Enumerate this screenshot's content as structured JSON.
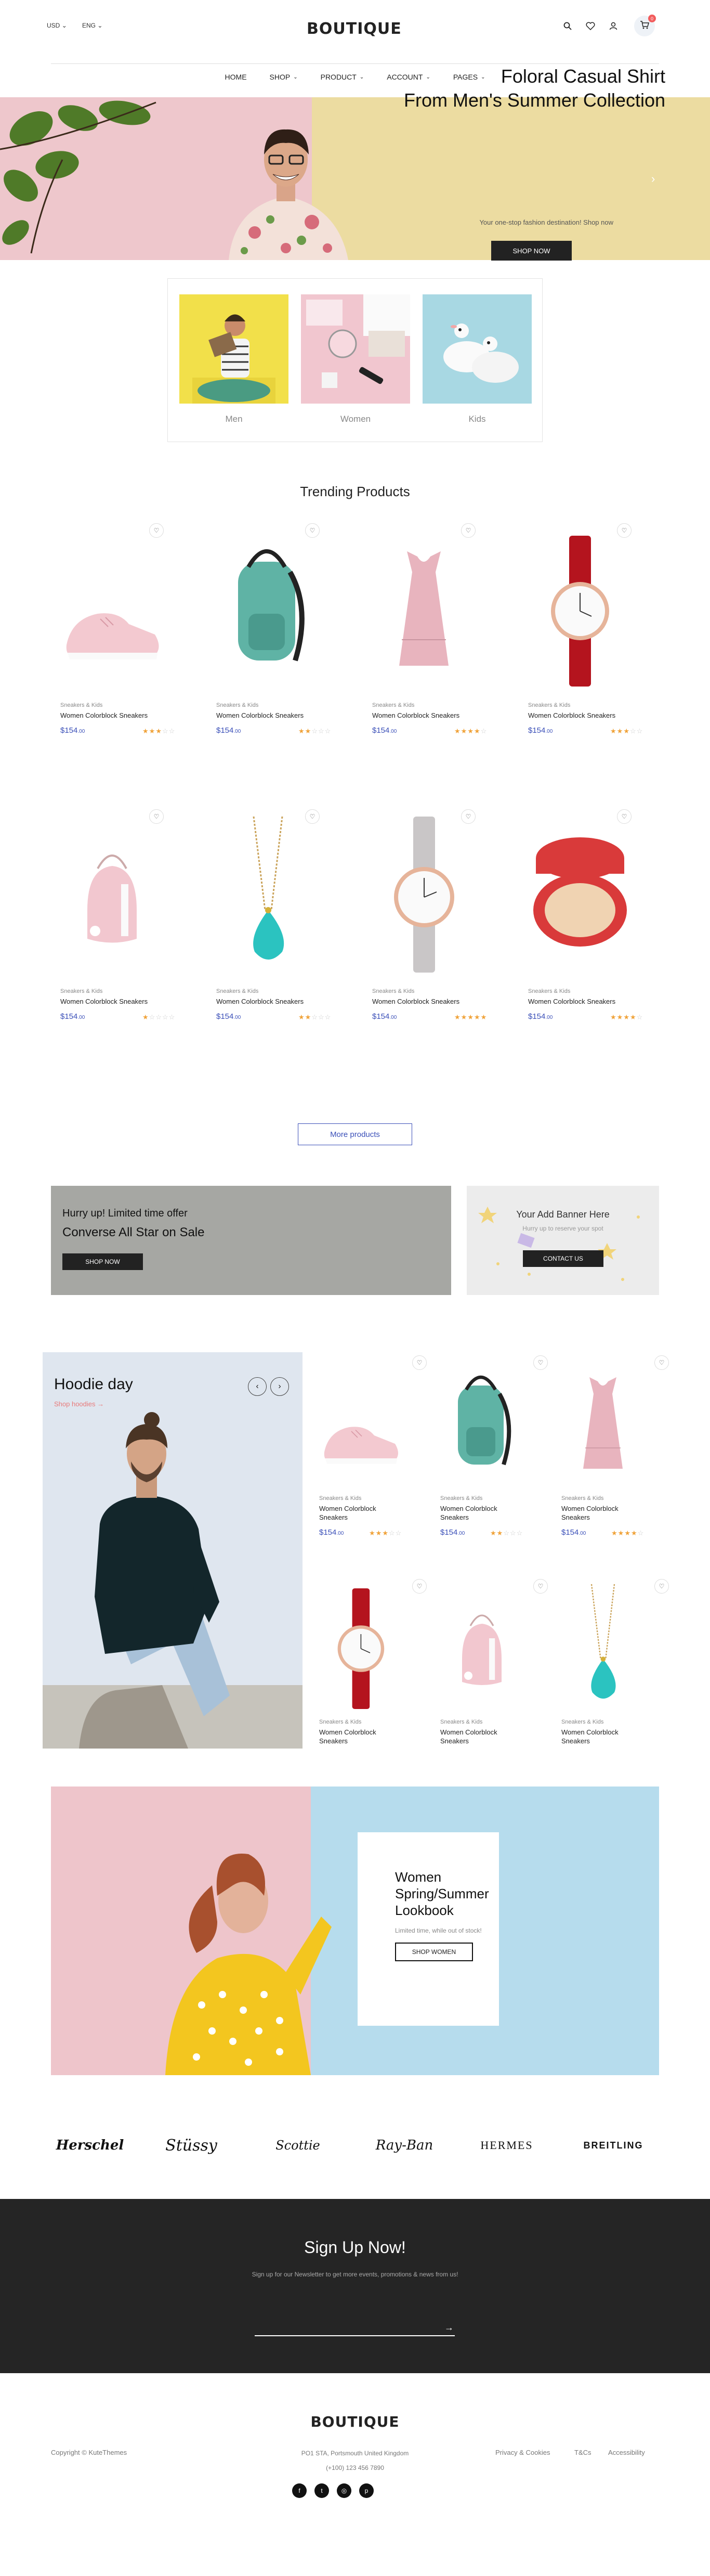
{
  "header": {
    "currency": "USD",
    "language": "ENG",
    "logo": "BOUTIQUE",
    "cart_count": "0"
  },
  "nav": {
    "items": [
      "HOME",
      "SHOP",
      "PRODUCT",
      "ACCOUNT",
      "PAGES"
    ]
  },
  "hero": {
    "title_line1": "Foloral Casual Shirt",
    "title_line2": "From Men's Summer Collection",
    "subtitle": "Your one-stop fashion destination! Shop now",
    "button": "SHOP NOW"
  },
  "categories": [
    "Men",
    "Women",
    "Kids"
  ],
  "trending": {
    "title": "Trending Products",
    "more": "More products",
    "products": [
      {
        "cat": "Sneakers & Kids",
        "name": "Women Colorblock Sneakers",
        "price": "$154",
        "cents": ".00",
        "stars": "★★★☆☆"
      },
      {
        "cat": "Sneakers & Kids",
        "name": "Women Colorblock Sneakers",
        "price": "$154",
        "cents": ".00",
        "stars": "★★☆☆☆"
      },
      {
        "cat": "Sneakers & Kids",
        "name": "Women Colorblock Sneakers",
        "price": "$154",
        "cents": ".00",
        "stars": "★★★★☆"
      },
      {
        "cat": "Sneakers & Kids",
        "name": "Women Colorblock Sneakers",
        "price": "$154",
        "cents": ".00",
        "stars": "★★★☆☆"
      },
      {
        "cat": "Sneakers & Kids",
        "name": "Women Colorblock Sneakers",
        "price": "$154",
        "cents": ".00",
        "stars": "★☆☆☆☆"
      },
      {
        "cat": "Sneakers & Kids",
        "name": "Women Colorblock Sneakers",
        "price": "$154",
        "cents": ".00",
        "stars": "★★☆☆☆"
      },
      {
        "cat": "Sneakers & Kids",
        "name": "Women Colorblock Sneakers",
        "price": "$154",
        "cents": ".00",
        "stars": "★★★★★"
      },
      {
        "cat": "Sneakers & Kids",
        "name": "Women Colorblock Sneakers",
        "price": "$154",
        "cents": ".00",
        "stars": "★★★★☆"
      }
    ]
  },
  "banner1": {
    "line1": "Hurry up! Limited time offer",
    "line2": "Converse All Star on Sale",
    "button": "SHOP NOW"
  },
  "banner2": {
    "title": "Your Add Banner Here",
    "sub": "Hurry up to reserve your spot",
    "button": "CONTACT US"
  },
  "hoodie": {
    "title": "Hoodie day",
    "link": "Shop hoodies →",
    "products": [
      {
        "cat": "Sneakers & Kids",
        "name": "Women Colorblock Sneakers",
        "price": "$154",
        "cents": ".00",
        "stars": "★★★☆☆"
      },
      {
        "cat": "Sneakers & Kids",
        "name": "Women Colorblock Sneakers",
        "price": "$154",
        "cents": ".00",
        "stars": "★★☆☆☆"
      },
      {
        "cat": "Sneakers & Kids",
        "name": "Women Colorblock Sneakers",
        "price": "$154",
        "cents": ".00",
        "stars": "★★★★☆"
      },
      {
        "cat": "Sneakers & Kids",
        "name": "Women Colorblock Sneakers",
        "price": "",
        "cents": "",
        "stars": ""
      },
      {
        "cat": "Sneakers & Kids",
        "name": "Women Colorblock Sneakers",
        "price": "",
        "cents": "",
        "stars": ""
      },
      {
        "cat": "Sneakers & Kids",
        "name": "Women Colorblock Sneakers",
        "price": "",
        "cents": "",
        "stars": ""
      }
    ]
  },
  "lookbook": {
    "title_line1": "Women",
    "title_line2": "Spring/Summer",
    "title_line3": "Lookbook",
    "sub": "Limited time, while out of stock!",
    "button": "SHOP WOMEN"
  },
  "brands": [
    "Herschel",
    "Stüssy",
    "Scottie",
    "Ray-Ban",
    "HERMES",
    "BREITLING"
  ],
  "signup": {
    "title": "Sign Up Now!",
    "sub": "Sign up for our Newsletter to get more events, promotions & news from us!"
  },
  "footer": {
    "logo": "BOUTIQUE",
    "copyright": "Copyright © KuteThemes",
    "address": "PO1 STA, Portsmouth United Kingdom",
    "phone": "(+100) 123 456 7890",
    "links": [
      "Privacy & Cookies",
      "T&Cs",
      "Accessibility"
    ]
  },
  "colors": {
    "accent": "#3a4fb8",
    "star": "#f0a33a",
    "badge": "#f25c5c",
    "dark": "#252525"
  }
}
